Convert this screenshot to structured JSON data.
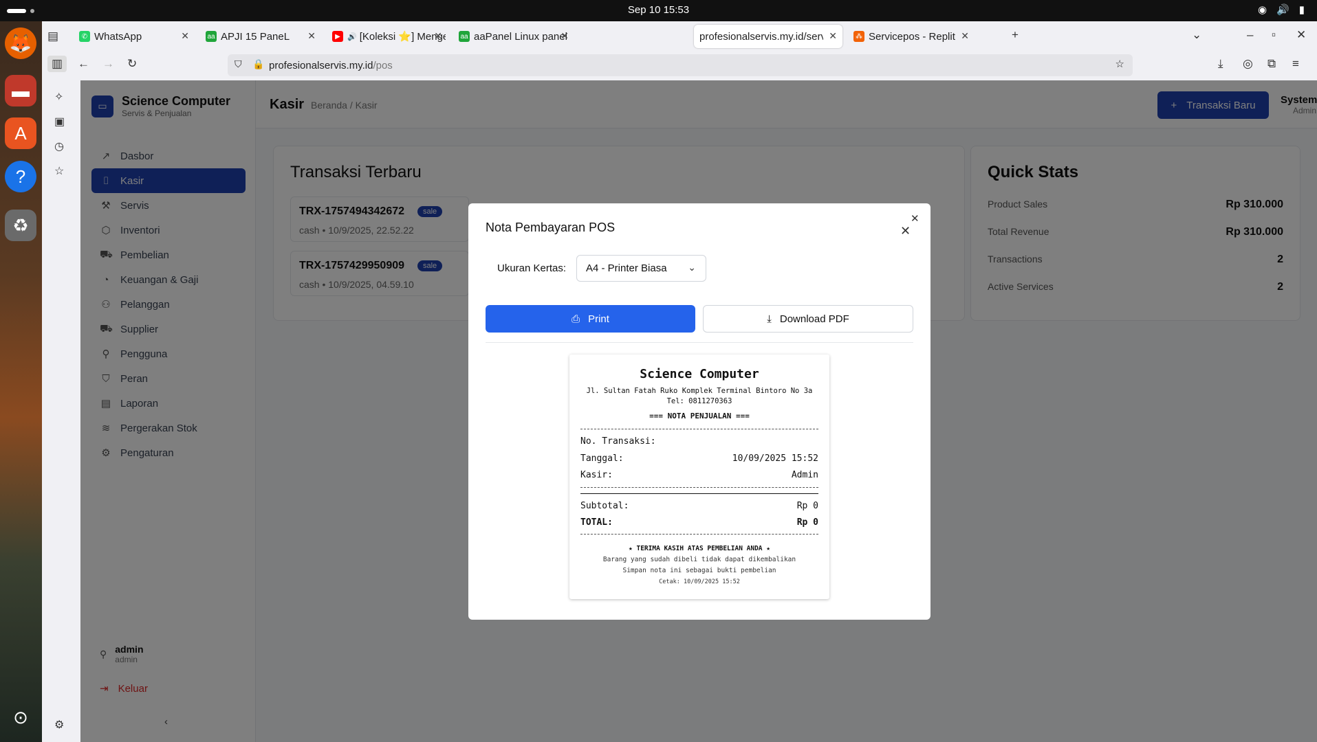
{
  "system": {
    "clock": "Sep 10  15:53"
  },
  "browser": {
    "tabs": [
      {
        "label": "WhatsApp",
        "icon": "whatsapp-icon"
      },
      {
        "label": "APJI 15 PaneL",
        "icon": "aapanel-icon"
      },
      {
        "label": "[Koleksi ⭐] Menge",
        "icon": "youtube-icon"
      },
      {
        "label": "aaPanel Linux panel",
        "icon": "aapanel-icon"
      },
      {
        "label": "profesionalservis.my.id/servi",
        "icon": "none"
      },
      {
        "label": "Servicepos - Replit",
        "icon": "replit-icon"
      }
    ],
    "url_host": "profesionalservis.my.id",
    "url_path": "/pos"
  },
  "app": {
    "brand_name": "Science Computer",
    "brand_sub": "Servis & Penjualan",
    "nav": [
      {
        "label": "Dasbor",
        "icon": "chart-icon"
      },
      {
        "label": "Kasir",
        "icon": "scan-icon",
        "active": true
      },
      {
        "label": "Servis",
        "icon": "wrench-icon"
      },
      {
        "label": "Inventori",
        "icon": "box-icon"
      },
      {
        "label": "Pembelian",
        "icon": "cart-icon"
      },
      {
        "label": "Keuangan & Gaji",
        "icon": "pie-icon"
      },
      {
        "label": "Pelanggan",
        "icon": "users-icon"
      },
      {
        "label": "Supplier",
        "icon": "truck-icon"
      },
      {
        "label": "Pengguna",
        "icon": "user-key-icon"
      },
      {
        "label": "Peran",
        "icon": "shield-icon"
      },
      {
        "label": "Laporan",
        "icon": "file-icon"
      },
      {
        "label": "Pergerakan Stok",
        "icon": "layers-icon"
      },
      {
        "label": "Pengaturan",
        "icon": "gear-icon"
      }
    ],
    "user_name": "admin",
    "user_role": "admin",
    "logout_label": "Keluar",
    "header": {
      "title": "Kasir",
      "breadcrumb": "Beranda / Kasir",
      "new_txn_label": "Transaksi Baru",
      "account_name": "System",
      "account_role": "Admin"
    },
    "recent": {
      "title": "Transaksi Terbaru",
      "items": [
        {
          "id": "TRX-1757494342672",
          "badge": "sale",
          "meta": "cash • 10/9/2025, 22.52.22"
        },
        {
          "id": "TRX-1757429950909",
          "badge": "sale",
          "meta": "cash • 10/9/2025, 04.59.10"
        }
      ]
    },
    "stats": {
      "title": "Quick Stats",
      "rows": [
        {
          "label": "Product Sales",
          "value": "Rp 310.000"
        },
        {
          "label": "Total Revenue",
          "value": "Rp 310.000"
        },
        {
          "label": "Transactions",
          "value": "2"
        },
        {
          "label": "Active Services",
          "value": "2"
        }
      ]
    }
  },
  "modal": {
    "title": "Nota Pembayaran POS",
    "paper_label": "Ukuran Kertas:",
    "paper_value": "A4 - Printer Biasa",
    "print_label": "Print",
    "pdf_label": "Download PDF",
    "receipt": {
      "store": "Science Computer",
      "address": "Jl. Sultan Fatah Ruko Komplek Terminal Bintoro No 3a",
      "tel": "Tel: 0811270363",
      "heading": "=== NOTA PENJUALAN ===",
      "txn_label": "No. Transaksi:",
      "txn_value": "",
      "date_label": "Tanggal:",
      "date_value": "10/09/2025 15:52",
      "cashier_label": "Kasir:",
      "cashier_value": "Admin",
      "subtotal_label": "Subtotal:",
      "subtotal_value": "Rp 0",
      "total_label": "TOTAL:",
      "total_value": "Rp 0",
      "thanks": "★ TERIMA KASIH ATAS PEMBELIAN ANDA ★",
      "note1": "Barang yang sudah dibeli tidak dapat dikembalikan",
      "note2": "Simpan nota ini sebagai bukti pembelian",
      "printed": "Cetak: 10/09/2025 15:52"
    }
  }
}
